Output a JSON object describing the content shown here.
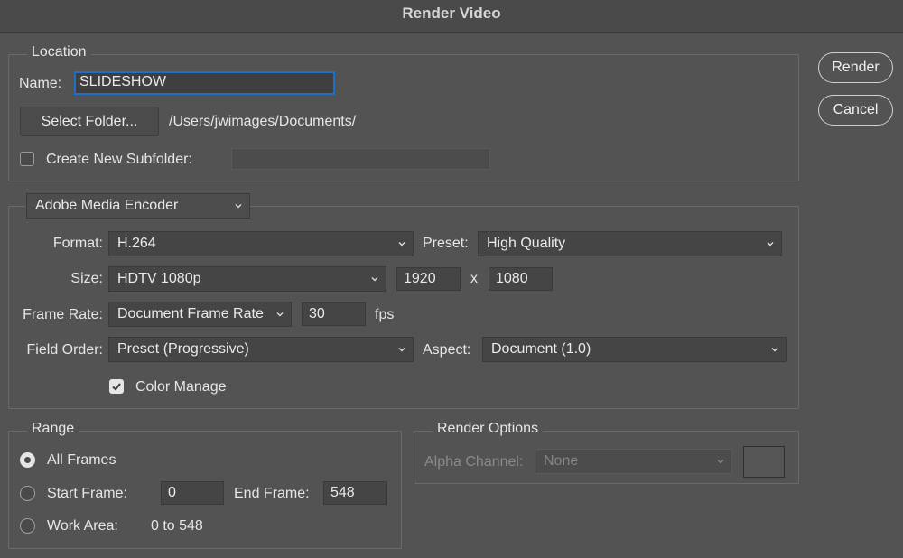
{
  "window": {
    "title": "Render Video"
  },
  "actions": {
    "render_label": "Render",
    "cancel_label": "Cancel"
  },
  "location": {
    "legend": "Location",
    "name_label": "Name:",
    "name_value": "SLIDESHOW",
    "select_folder_label": "Select Folder...",
    "folder_path": "/Users/jwimages/Documents/",
    "subfolder_label": "Create New Subfolder:",
    "subfolder_value": "",
    "subfolder_checked": false
  },
  "encoder": {
    "selected": "Adobe Media Encoder",
    "format_label": "Format:",
    "format_value": "H.264",
    "preset_label": "Preset:",
    "preset_value": "High Quality",
    "size_label": "Size:",
    "size_value": "HDTV 1080p",
    "width": "1920",
    "x_sep": "x",
    "height": "1080",
    "frame_rate_label": "Frame Rate:",
    "frame_rate_value": "Document Frame Rate",
    "fps_value": "30",
    "fps_unit": "fps",
    "field_order_label": "Field Order:",
    "field_order_value": "Preset (Progressive)",
    "aspect_label": "Aspect:",
    "aspect_value": "Document (1.0)",
    "color_manage_label": "Color Manage",
    "color_manage_checked": true
  },
  "range": {
    "legend": "Range",
    "all_frames_label": "All Frames",
    "start_frame_label": "Start Frame:",
    "start_frame_value": "0",
    "end_frame_label": "End Frame:",
    "end_frame_value": "548",
    "work_area_label": "Work Area:",
    "work_area_value": "0 to 548",
    "selected": "All Frames"
  },
  "render_options": {
    "legend": "Render Options",
    "alpha_label": "Alpha Channel:",
    "alpha_value": "None"
  },
  "colors": {
    "focus_ring": "#1f6fc6",
    "background": "#535353"
  }
}
